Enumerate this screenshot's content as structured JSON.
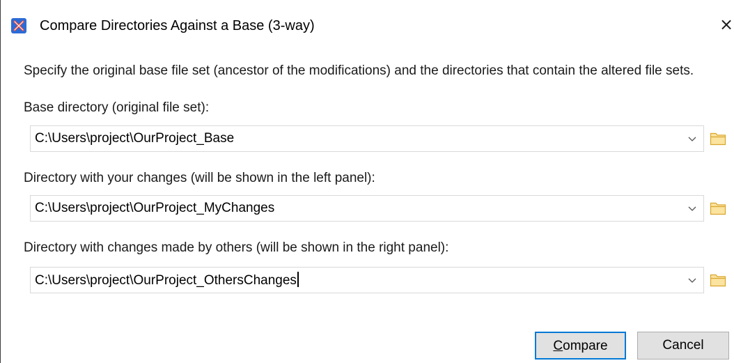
{
  "dialog": {
    "title": "Compare Directories Against a Base (3-way)",
    "close_glyph": "×",
    "instructions": "Specify the original base file set (ancestor of the modifications) and the directories that contain the altered file sets."
  },
  "fields": {
    "base": {
      "label": "Base directory (original file set):",
      "value": "C:\\Users\\project\\OurProject_Base"
    },
    "mine": {
      "label": "Directory with your changes (will be shown in the left panel):",
      "value": "C:\\Users\\project\\OurProject_MyChanges"
    },
    "others": {
      "label": "Directory with changes made by others (will be shown in the right panel):",
      "value": "C:\\Users\\project\\OurProject_OthersChanges"
    }
  },
  "buttons": {
    "compare_mnemonic": "C",
    "compare_rest": "ompare",
    "cancel": "Cancel"
  },
  "icons": {
    "app": "app-logo-icon",
    "dropdown": "chevron-down-icon",
    "browse": "folder-icon"
  },
  "colors": {
    "focus_border": "#0078d7",
    "folder": "#f2c44f",
    "app_icon": "#2c6bd6"
  }
}
